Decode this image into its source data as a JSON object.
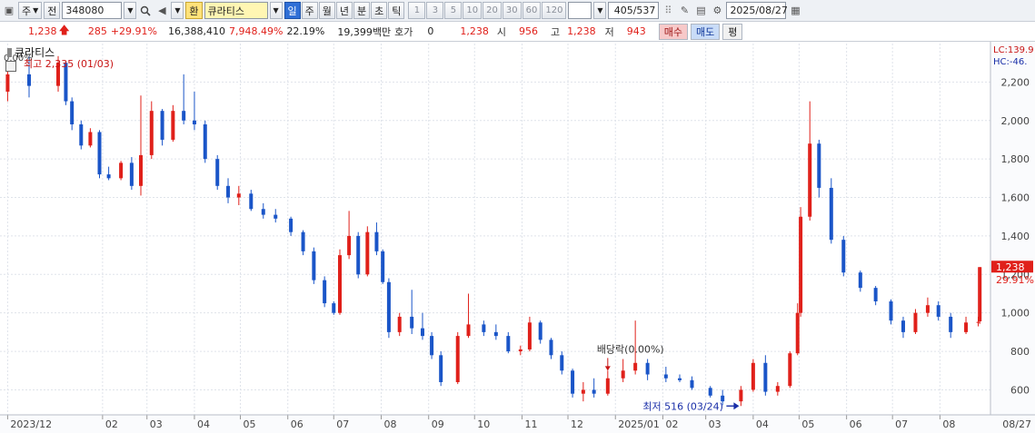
{
  "toolbar": {
    "type_label": "주",
    "prev_label": "전",
    "code": "348080",
    "hwan_label": "환",
    "name": "큐라티스",
    "periods": [
      "일",
      "주",
      "월",
      "년",
      "분",
      "초",
      "틱"
    ],
    "active_period": "일",
    "numbers": [
      "1",
      "3",
      "5",
      "10",
      "20",
      "30",
      "60",
      "120"
    ],
    "count": "405/537",
    "date": "2025/08/27"
  },
  "quote": {
    "price": "1,238",
    "change": "285",
    "change_pct": "+29.91%",
    "volume": "16,388,410",
    "volume_pct": "7,948.49%",
    "turnover": "22.19%",
    "amount": "19,399백만",
    "hoga_label": "호가",
    "hoga_value": "0",
    "hoga_price": "1,238",
    "open_label": "시",
    "open": "956",
    "high_label": "고",
    "high": "1,238",
    "low_label": "저",
    "low": "943",
    "buy_label": "매수",
    "sell_label": "매도",
    "flat_label": "평"
  },
  "chart_data": {
    "type": "candlestick",
    "legend": "큐라티스",
    "series_name": "큐라티스",
    "ylim": [
      470,
      2400
    ],
    "yticks": [
      600,
      800,
      1000,
      1200,
      1400,
      1600,
      1800,
      2000,
      2200
    ],
    "ytick_labels": [
      "600",
      "800",
      "1,000",
      "1,200",
      "1,400",
      "1,600",
      "1,800",
      "2,000",
      "2,200"
    ],
    "xticks": [
      {
        "label": "2023/12",
        "date": "2023-12-01"
      },
      {
        "label": "02",
        "date": "2024-02-01"
      },
      {
        "label": "03",
        "date": "2024-03-01"
      },
      {
        "label": "04",
        "date": "2024-04-01"
      },
      {
        "label": "05",
        "date": "2024-05-01"
      },
      {
        "label": "06",
        "date": "2024-06-01"
      },
      {
        "label": "07",
        "date": "2024-07-01"
      },
      {
        "label": "08",
        "date": "2024-08-01"
      },
      {
        "label": "09",
        "date": "2024-09-01"
      },
      {
        "label": "10",
        "date": "2024-10-01"
      },
      {
        "label": "11",
        "date": "2024-11-01"
      },
      {
        "label": "12",
        "date": "2024-12-01"
      },
      {
        "label": "2025/01",
        "date": "2025-01-01"
      },
      {
        "label": "02",
        "date": "2025-02-01"
      },
      {
        "label": "03",
        "date": "2025-03-01"
      },
      {
        "label": "04",
        "date": "2025-04-01"
      },
      {
        "label": "05",
        "date": "2025-05-01"
      },
      {
        "label": "06",
        "date": "2025-06-01"
      },
      {
        "label": "07",
        "date": "2025-07-01"
      },
      {
        "label": "08",
        "date": "2025-08-01"
      }
    ],
    "x_end_label": "08/27",
    "candles": [
      {
        "date": "2023-12-01",
        "o": 2150,
        "h": 2280,
        "l": 2100,
        "c": 2240
      },
      {
        "date": "2023-12-15",
        "o": 2240,
        "h": 2335,
        "l": 2120,
        "c": 2180
      },
      {
        "date": "2024-01-03",
        "o": 2180,
        "h": 2335,
        "l": 2150,
        "c": 2300
      },
      {
        "date": "2024-01-08",
        "o": 2300,
        "h": 2310,
        "l": 2080,
        "c": 2100
      },
      {
        "date": "2024-01-12",
        "o": 2100,
        "h": 2120,
        "l": 1950,
        "c": 1980
      },
      {
        "date": "2024-01-18",
        "o": 1980,
        "h": 2000,
        "l": 1850,
        "c": 1870
      },
      {
        "date": "2024-01-24",
        "o": 1870,
        "h": 1960,
        "l": 1860,
        "c": 1940
      },
      {
        "date": "2024-01-30",
        "o": 1940,
        "h": 1950,
        "l": 1700,
        "c": 1720
      },
      {
        "date": "2024-02-05",
        "o": 1720,
        "h": 1760,
        "l": 1690,
        "c": 1700
      },
      {
        "date": "2024-02-13",
        "o": 1700,
        "h": 1790,
        "l": 1690,
        "c": 1780
      },
      {
        "date": "2024-02-20",
        "o": 1780,
        "h": 1810,
        "l": 1640,
        "c": 1660
      },
      {
        "date": "2024-02-26",
        "o": 1660,
        "h": 2130,
        "l": 1610,
        "c": 1820
      },
      {
        "date": "2024-03-04",
        "o": 1820,
        "h": 2100,
        "l": 1800,
        "c": 2050
      },
      {
        "date": "2024-03-11",
        "o": 2050,
        "h": 2060,
        "l": 1870,
        "c": 1900
      },
      {
        "date": "2024-03-18",
        "o": 1900,
        "h": 2080,
        "l": 1890,
        "c": 2050
      },
      {
        "date": "2024-03-25",
        "o": 2050,
        "h": 2240,
        "l": 1980,
        "c": 2000
      },
      {
        "date": "2024-04-01",
        "o": 2000,
        "h": 2150,
        "l": 1950,
        "c": 1980
      },
      {
        "date": "2024-04-08",
        "o": 1980,
        "h": 2000,
        "l": 1780,
        "c": 1800
      },
      {
        "date": "2024-04-16",
        "o": 1800,
        "h": 1820,
        "l": 1640,
        "c": 1660
      },
      {
        "date": "2024-04-23",
        "o": 1660,
        "h": 1700,
        "l": 1570,
        "c": 1600
      },
      {
        "date": "2024-04-30",
        "o": 1600,
        "h": 1660,
        "l": 1560,
        "c": 1620
      },
      {
        "date": "2024-05-08",
        "o": 1620,
        "h": 1640,
        "l": 1530,
        "c": 1540
      },
      {
        "date": "2024-05-16",
        "o": 1540,
        "h": 1570,
        "l": 1490,
        "c": 1510
      },
      {
        "date": "2024-05-24",
        "o": 1510,
        "h": 1540,
        "l": 1470,
        "c": 1490
      },
      {
        "date": "2024-06-03",
        "o": 1490,
        "h": 1500,
        "l": 1400,
        "c": 1420
      },
      {
        "date": "2024-06-11",
        "o": 1420,
        "h": 1430,
        "l": 1300,
        "c": 1320
      },
      {
        "date": "2024-06-18",
        "o": 1320,
        "h": 1340,
        "l": 1150,
        "c": 1170
      },
      {
        "date": "2024-06-25",
        "o": 1170,
        "h": 1190,
        "l": 1030,
        "c": 1050
      },
      {
        "date": "2024-07-01",
        "o": 1050,
        "h": 1060,
        "l": 990,
        "c": 1000
      },
      {
        "date": "2024-07-05",
        "o": 1000,
        "h": 1330,
        "l": 990,
        "c": 1300
      },
      {
        "date": "2024-07-11",
        "o": 1300,
        "h": 1530,
        "l": 1280,
        "c": 1400
      },
      {
        "date": "2024-07-17",
        "o": 1400,
        "h": 1420,
        "l": 1180,
        "c": 1200
      },
      {
        "date": "2024-07-23",
        "o": 1200,
        "h": 1450,
        "l": 1190,
        "c": 1420
      },
      {
        "date": "2024-07-29",
        "o": 1420,
        "h": 1470,
        "l": 1300,
        "c": 1320
      },
      {
        "date": "2024-08-02",
        "o": 1320,
        "h": 1330,
        "l": 1150,
        "c": 1160
      },
      {
        "date": "2024-08-06",
        "o": 1160,
        "h": 1180,
        "l": 870,
        "c": 900
      },
      {
        "date": "2024-08-13",
        "o": 900,
        "h": 1000,
        "l": 880,
        "c": 980
      },
      {
        "date": "2024-08-21",
        "o": 980,
        "h": 1120,
        "l": 890,
        "c": 920
      },
      {
        "date": "2024-08-28",
        "o": 920,
        "h": 1000,
        "l": 860,
        "c": 880
      },
      {
        "date": "2024-09-03",
        "o": 880,
        "h": 900,
        "l": 760,
        "c": 780
      },
      {
        "date": "2024-09-09",
        "o": 780,
        "h": 800,
        "l": 620,
        "c": 640
      },
      {
        "date": "2024-09-20",
        "o": 640,
        "h": 900,
        "l": 630,
        "c": 880
      },
      {
        "date": "2024-09-27",
        "o": 880,
        "h": 1100,
        "l": 870,
        "c": 940
      },
      {
        "date": "2024-10-07",
        "o": 940,
        "h": 960,
        "l": 880,
        "c": 900
      },
      {
        "date": "2024-10-15",
        "o": 900,
        "h": 940,
        "l": 860,
        "c": 880
      },
      {
        "date": "2024-10-23",
        "o": 880,
        "h": 900,
        "l": 790,
        "c": 800
      },
      {
        "date": "2024-10-31",
        "o": 800,
        "h": 830,
        "l": 780,
        "c": 810
      },
      {
        "date": "2024-11-06",
        "o": 810,
        "h": 980,
        "l": 800,
        "c": 950
      },
      {
        "date": "2024-11-13",
        "o": 950,
        "h": 960,
        "l": 840,
        "c": 860
      },
      {
        "date": "2024-11-20",
        "o": 860,
        "h": 870,
        "l": 760,
        "c": 780
      },
      {
        "date": "2024-11-27",
        "o": 780,
        "h": 800,
        "l": 680,
        "c": 700
      },
      {
        "date": "2024-12-04",
        "o": 700,
        "h": 710,
        "l": 560,
        "c": 580
      },
      {
        "date": "2024-12-11",
        "o": 580,
        "h": 640,
        "l": 540,
        "c": 600
      },
      {
        "date": "2024-12-18",
        "o": 600,
        "h": 660,
        "l": 560,
        "c": 580
      },
      {
        "date": "2024-12-27",
        "o": 580,
        "h": 700,
        "l": 570,
        "c": 660
      },
      {
        "date": "2025-01-06",
        "o": 660,
        "h": 760,
        "l": 640,
        "c": 700
      },
      {
        "date": "2025-01-14",
        "o": 700,
        "h": 960,
        "l": 680,
        "c": 740
      },
      {
        "date": "2025-01-22",
        "o": 740,
        "h": 760,
        "l": 650,
        "c": 680
      },
      {
        "date": "2025-02-03",
        "o": 680,
        "h": 720,
        "l": 640,
        "c": 660
      },
      {
        "date": "2025-02-12",
        "o": 660,
        "h": 680,
        "l": 640,
        "c": 650
      },
      {
        "date": "2025-02-20",
        "o": 650,
        "h": 670,
        "l": 600,
        "c": 610
      },
      {
        "date": "2025-03-04",
        "o": 610,
        "h": 620,
        "l": 560,
        "c": 570
      },
      {
        "date": "2025-03-12",
        "o": 570,
        "h": 600,
        "l": 520,
        "c": 540
      },
      {
        "date": "2025-03-24",
        "o": 540,
        "h": 620,
        "l": 516,
        "c": 600
      },
      {
        "date": "2025-04-01",
        "o": 600,
        "h": 760,
        "l": 590,
        "c": 740
      },
      {
        "date": "2025-04-09",
        "o": 740,
        "h": 780,
        "l": 570,
        "c": 590
      },
      {
        "date": "2025-04-17",
        "o": 590,
        "h": 640,
        "l": 570,
        "c": 620
      },
      {
        "date": "2025-04-25",
        "o": 620,
        "h": 800,
        "l": 610,
        "c": 790
      },
      {
        "date": "2025-04-30",
        "o": 790,
        "h": 1050,
        "l": 780,
        "c": 1000
      },
      {
        "date": "2025-05-02",
        "o": 1000,
        "h": 1550,
        "l": 980,
        "c": 1500
      },
      {
        "date": "2025-05-08",
        "o": 1500,
        "h": 2100,
        "l": 1480,
        "c": 1880
      },
      {
        "date": "2025-05-14",
        "o": 1880,
        "h": 1900,
        "l": 1600,
        "c": 1650
      },
      {
        "date": "2025-05-22",
        "o": 1650,
        "h": 1700,
        "l": 1360,
        "c": 1380
      },
      {
        "date": "2025-05-30",
        "o": 1380,
        "h": 1400,
        "l": 1190,
        "c": 1210
      },
      {
        "date": "2025-06-10",
        "o": 1210,
        "h": 1220,
        "l": 1110,
        "c": 1130
      },
      {
        "date": "2025-06-20",
        "o": 1130,
        "h": 1140,
        "l": 1040,
        "c": 1060
      },
      {
        "date": "2025-06-30",
        "o": 1060,
        "h": 1070,
        "l": 940,
        "c": 960
      },
      {
        "date": "2025-07-08",
        "o": 960,
        "h": 980,
        "l": 870,
        "c": 900
      },
      {
        "date": "2025-07-16",
        "o": 900,
        "h": 1020,
        "l": 890,
        "c": 1000
      },
      {
        "date": "2025-07-24",
        "o": 1000,
        "h": 1080,
        "l": 980,
        "c": 1040
      },
      {
        "date": "2025-07-31",
        "o": 1040,
        "h": 1060,
        "l": 960,
        "c": 980
      },
      {
        "date": "2025-08-08",
        "o": 980,
        "h": 1000,
        "l": 870,
        "c": 900
      },
      {
        "date": "2025-08-18",
        "o": 900,
        "h": 980,
        "l": 890,
        "c": 950
      },
      {
        "date": "2025-08-26",
        "o": 950,
        "h": 980,
        "l": 930,
        "c": 953
      },
      {
        "date": "2025-08-27",
        "o": 956,
        "h": 1238,
        "l": 943,
        "c": 1238
      }
    ],
    "annotations": {
      "high_label": "최고 2,335 (01/03)",
      "high_date": "2024-01-03",
      "high_value": 2335,
      "low_label": "최저 516 (03/24)",
      "low_date": "2025-03-24",
      "low_value": 516,
      "dividend_label": "배당락(0.00%)",
      "dividend_date": "2024-12-27",
      "dividend_value": 690,
      "topleft_label": "0.00%",
      "lc_label": "LC:139.9",
      "hc_label": "HC:-46.",
      "last_price_label": "1,238",
      "last_pct_label": "29.91%",
      "last_price": 1238
    },
    "colors": {
      "up": "#e0201a",
      "down": "#1a55c8",
      "grid": "#dfe3ea",
      "axis_text": "#444444",
      "annotation_high": "#c81414",
      "annotation_low": "#1a2fa8",
      "price_box": "#e0201a"
    }
  }
}
